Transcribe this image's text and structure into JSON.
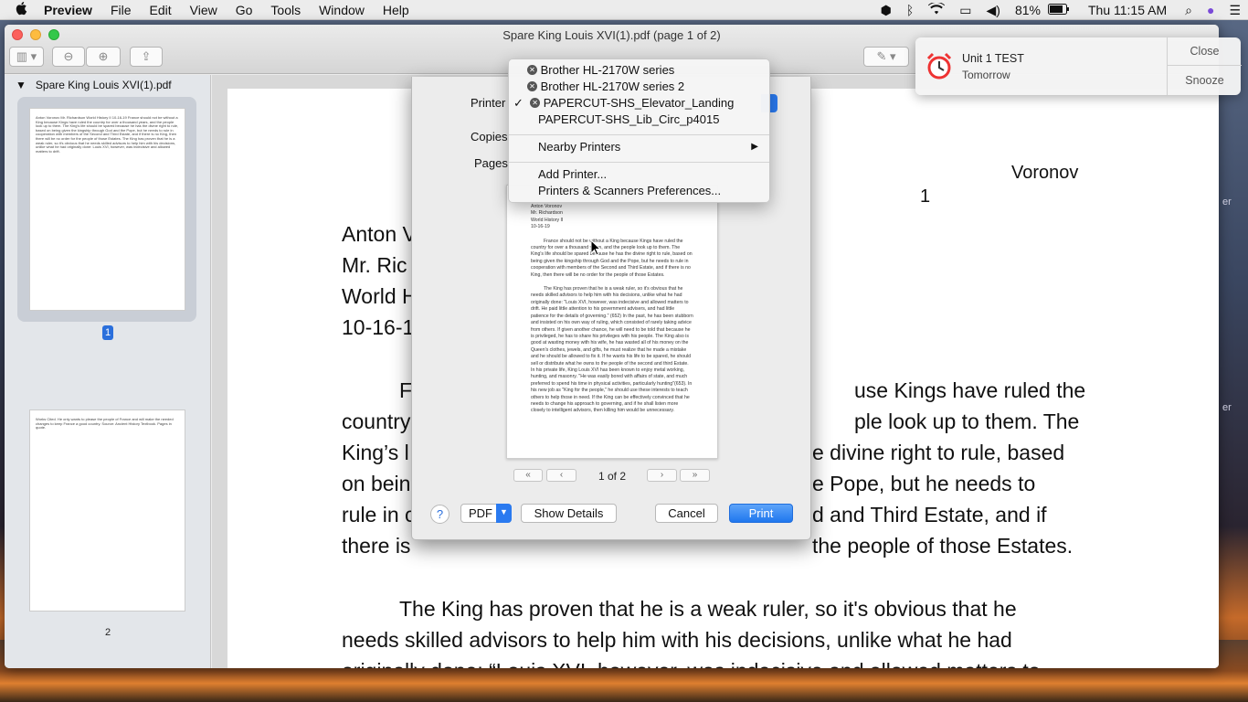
{
  "menubar": {
    "apple": "",
    "app": "Preview",
    "items": [
      "File",
      "Edit",
      "View",
      "Go",
      "Tools",
      "Window",
      "Help"
    ],
    "battery": "81%",
    "clock": "Thu 11:15 AM"
  },
  "window": {
    "title": "Spare King Louis XVI(1).pdf (page 1 of 2)",
    "sidebar_title": "Spare King Louis XVI(1).pdf",
    "thumb_labels": [
      "1",
      "2"
    ],
    "thumb1_text": "Anton Voronov Mr. Richardson World History II 10-16-19 France should not be without a King because Kings have ruled the country for over a thousand years, and the people look up to them. The King's life should be spared because he has the divine right to rule, based on being given the kingship through God and the Pope, but he needs to rule in cooperation with members of the Second and Third Estate, and if there is no King, then there will be no order for the people of those Estates. The King has proven that he is a weak ruler, so it's obvious that he needs skilled advisors to help him with his decisions, unlike what he had originally done: Louis XVI, however, was indecisive and allowed matters to drift.",
    "thumb2_text": "Works Cited. He only wants to please the people of France and will make the needed changes to keep France a good country. Source: Ancient History Textbook. Pages in quote."
  },
  "document": {
    "header_name": "Voronov",
    "header_page": "1",
    "lines_left": [
      "Anton V",
      "Mr. Ric",
      "World H",
      "10-16-1"
    ],
    "para1": [
      "F",
      "country",
      "King’s l",
      "on bein",
      "rule in c",
      "there is"
    ],
    "para1_right": [
      "use Kings have ruled the",
      "ple look up to them. The",
      "e divine right to rule, based",
      "e Pope, but he needs to",
      "d and Third Estate, and if",
      "the people of those Estates."
    ],
    "para2": [
      "The King has proven that he is a weak ruler, so it's obvious that he",
      "needs skilled advisors to help him with his decisions, unlike what he had",
      "originally done: “Louis XVI, however, was indecisive and allowed matters to"
    ]
  },
  "dialog": {
    "printer_label": "Printer",
    "copies_label": "Copies",
    "pages_label": "Pages",
    "page_indicator": "1 of 2",
    "pdf_label": "PDF",
    "show_details": "Show Details",
    "cancel": "Cancel",
    "print": "Print",
    "help": "?",
    "nav": [
      "«",
      "‹",
      "›",
      "»"
    ],
    "preview_header": [
      "Anton Voronov",
      "Mr. Richardson",
      "World History II",
      "10-16-19"
    ],
    "preview_p1": "France should not be without a King because Kings have ruled the country for over a thousand years, and the people look up to them. The King's life should be spared because he has the divine right to rule, based on being given the kingship through God and the Pope, but he needs to rule in cooperation with members of the Second and Third Estate, and if there is no King, then there will be no order for the people of those Estates.",
    "preview_p2": "The King has proven that he is a weak ruler, so it's obvious that he needs skilled advisors to help him with his decisions, unlike what he had originally done: \"Louis XVI, however, was indecisive and allowed matters to drift. He paid little attention to his government advisers, and had little patience for the details of governing.\" (652) In the past, he has been stubborn and insisted on his own way of ruling, which consisted of rarely taking advice from others. If given another chance, he will need to be told that because he is privileged, he has to share his privileges with his people. The King also is good at wasting money with his wife, he has wasted all of his money on the Queen's clothes, jewels, and gifts, he must realize that he made a mistake and he should be allowed to fix it. If he wants his life to be spared, he should sell or distribute what he owns to the people of the second and third Estate. In his private life, King Louis XVI has been known to enjoy metal working, hunting, and masonry. \"He was easily bored with affairs of state, and much preferred to spend his time in physical activities, particularly hunting\"(653). In his new job as \"King for the people,\" he should use these interests to teach others to help those in need. If the King can be effectively convinced that he needs to change his approach to governing, and if he shall listen more closely to intelligent advisors, then killing him would be unnecessary."
  },
  "printer_menu": {
    "printers": [
      "Brother HL-2170W series",
      "Brother HL-2170W series 2",
      "PAPERCUT-SHS_Elevator_Landing",
      "PAPERCUT-SHS_Lib_Circ_p4015"
    ],
    "selected_mark": "✓",
    "nearby": "Nearby Printers",
    "add": "Add Printer...",
    "prefs": "Printers & Scanners Preferences..."
  },
  "notification": {
    "title": "Unit 1 TEST",
    "subtitle": "Tomorrow",
    "close": "Close",
    "snooze": "Snooze"
  },
  "right_strip": [
    "er",
    "er"
  ]
}
